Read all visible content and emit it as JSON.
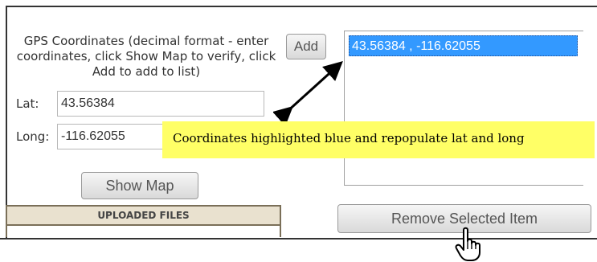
{
  "form": {
    "instructions": "GPS Coordinates (decimal format - enter coordinates, click Show Map to verify, click Add to add to list)",
    "lat_label": "Lat:",
    "lat_value": "43.56384",
    "long_label": "Long:",
    "long_value": "-116.62055",
    "add_button": "Add",
    "show_map_button": "Show Map"
  },
  "coordinates_list": {
    "items": [
      "43.56384 , -116.62055"
    ],
    "selected_index": 0
  },
  "remove_button": "Remove Selected Item",
  "uploaded_files": {
    "header": "UPLOADED FILES"
  },
  "annotation": {
    "text": "Coordinates highlighted blue and repopulate lat and long"
  },
  "colors": {
    "selection": "#3399ff",
    "note_background": "#ffff66",
    "table_header": "#e9e1cf"
  }
}
